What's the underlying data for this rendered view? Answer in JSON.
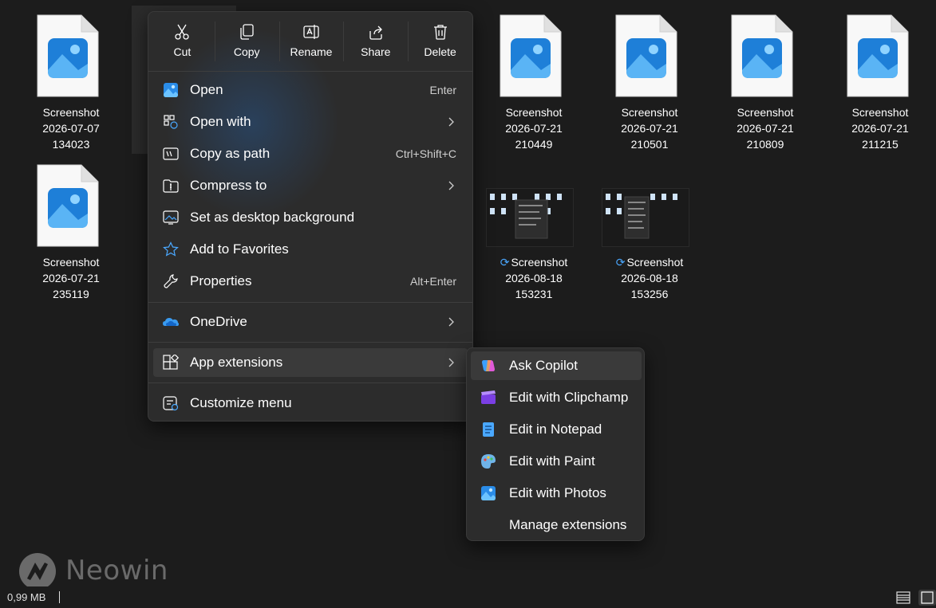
{
  "files": [
    {
      "lines": [
        "Screenshot",
        "2026-07-07",
        "134023"
      ]
    },
    {
      "lines": [
        "Screenshot",
        "2026-07-21",
        "210449"
      ]
    },
    {
      "lines": [
        "Screenshot",
        "2026-07-21",
        "210501"
      ]
    },
    {
      "lines": [
        "Screenshot",
        "2026-07-21",
        "210809"
      ]
    },
    {
      "lines": [
        "Screenshot",
        "2026-07-21",
        "211215"
      ]
    },
    {
      "lines": [
        "Screenshot",
        "2026-07-21",
        "235119"
      ]
    },
    {
      "lines": [
        "Screenshot",
        "2026-08-18",
        "153231"
      ]
    },
    {
      "lines": [
        "Screenshot",
        "2026-08-18",
        "153256"
      ]
    }
  ],
  "context_menu": {
    "toolbar": [
      {
        "label": "Cut",
        "icon": "scissors-icon"
      },
      {
        "label": "Copy",
        "icon": "copy-icon"
      },
      {
        "label": "Rename",
        "icon": "rename-icon"
      },
      {
        "label": "Share",
        "icon": "share-icon"
      },
      {
        "label": "Delete",
        "icon": "trash-icon"
      }
    ],
    "items": [
      {
        "label": "Open",
        "shortcut": "Enter",
        "icon": "photos-icon"
      },
      {
        "label": "Open with",
        "icon": "open-with-icon",
        "has_submenu": true
      },
      {
        "label": "Copy as path",
        "shortcut": "Ctrl+Shift+C",
        "icon": "copy-path-icon"
      },
      {
        "label": "Compress to",
        "icon": "compress-icon",
        "has_submenu": true
      },
      {
        "label": "Set as desktop background",
        "icon": "desktop-background-icon"
      },
      {
        "label": "Add to Favorites",
        "icon": "star-icon"
      },
      {
        "label": "Properties",
        "shortcut": "Alt+Enter",
        "icon": "wrench-icon"
      },
      {
        "label": "OneDrive",
        "icon": "onedrive-icon",
        "has_submenu": true
      },
      {
        "label": "App extensions",
        "icon": "app-extensions-icon",
        "has_submenu": true
      },
      {
        "label": "Customize menu",
        "icon": "customize-menu-icon"
      }
    ]
  },
  "submenu": {
    "items": [
      {
        "label": "Ask Copilot",
        "icon": "copilot-icon"
      },
      {
        "label": "Edit with Clipchamp",
        "icon": "clipchamp-icon"
      },
      {
        "label": "Edit in Notepad",
        "icon": "notepad-icon"
      },
      {
        "label": "Edit with Paint",
        "icon": "paint-icon"
      },
      {
        "label": "Edit with Photos",
        "icon": "photos-icon"
      },
      {
        "label": "Manage extensions"
      }
    ]
  },
  "watermark": {
    "text": "Neowin"
  },
  "status_bar": {
    "size": "0,99 MB"
  },
  "colors": {
    "background": "#1c1c1c",
    "menu": "#2c2c2c",
    "accent": "#4aa8ff"
  }
}
